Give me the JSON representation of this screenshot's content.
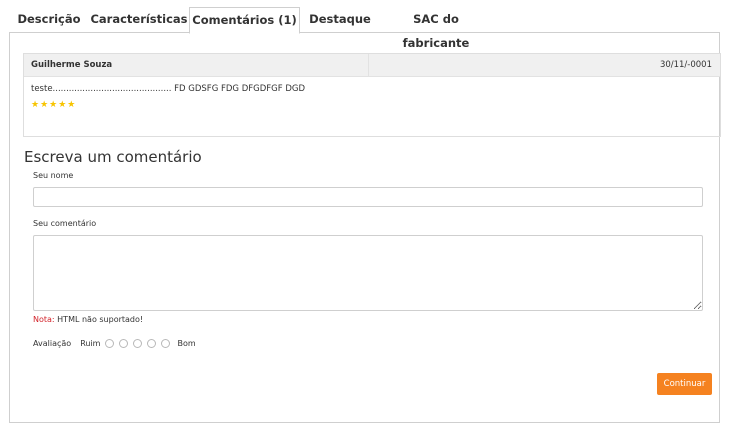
{
  "tabs": [
    {
      "label": "Descrição"
    },
    {
      "label": "Características"
    },
    {
      "label": "Comentários (1)"
    },
    {
      "label": "Destaque"
    },
    {
      "label": "SAC do fabricante"
    }
  ],
  "review": {
    "author": "Guilherme Souza",
    "date": "30/11/-0001",
    "text": "teste............................................ FD GDSFG FDG DFGDFGF DGD",
    "stars": "★★★★★",
    "rating": 5
  },
  "form": {
    "title": "Escreva um comentário",
    "name_label": "Seu nome",
    "name_value": "",
    "comment_label": "Seu comentário",
    "comment_value": "",
    "note_prefix": "Nota:",
    "note_text": " HTML não suportado!",
    "rating_label": "Avaliação",
    "rating_min": "Ruim",
    "rating_max": "Bom",
    "submit_label": "Continuar"
  },
  "colors": {
    "accent": "#f58220",
    "star": "#f7c400",
    "warning": "#d2232a"
  }
}
